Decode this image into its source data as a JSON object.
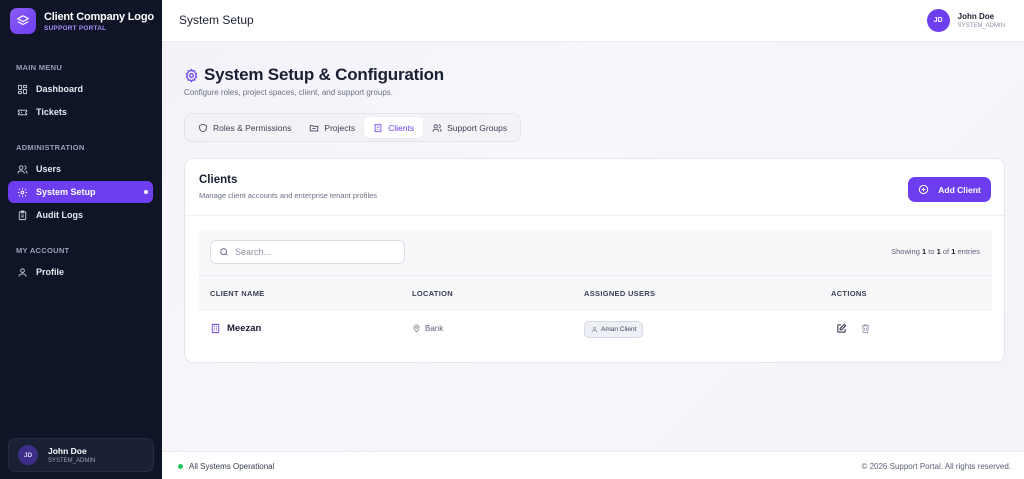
{
  "brand": {
    "title": "Client Company Logo",
    "subtitle": "SUPPORT PORTAL"
  },
  "sidebar": {
    "sections": [
      {
        "label": "MAIN MENU"
      },
      {
        "label": "ADMINISTRATION"
      },
      {
        "label": "MY ACCOUNT"
      }
    ],
    "items": [
      {
        "label": "Dashboard",
        "icon": "dashboard-icon"
      },
      {
        "label": "Tickets",
        "icon": "ticket-icon"
      },
      {
        "label": "Users",
        "icon": "users-icon"
      },
      {
        "label": "System Setup",
        "icon": "gear-icon",
        "active": true
      },
      {
        "label": "Audit Logs",
        "icon": "clipboard-icon"
      },
      {
        "label": "Profile",
        "icon": "user-icon"
      }
    ],
    "user": {
      "initials": "JD",
      "name": "John Doe",
      "role": "SYSTEM_ADMIN"
    }
  },
  "header": {
    "title": "System Setup",
    "user": {
      "initials": "JD",
      "name": "John Doe",
      "role": "SYSTEM_ADMIN"
    }
  },
  "page": {
    "title": "System Setup & Configuration",
    "subtitle": "Configure roles, project spaces, client, and support groups."
  },
  "tabs": [
    {
      "label": "Roles & Permissions",
      "icon": "shield-icon"
    },
    {
      "label": "Projects",
      "icon": "folder-icon"
    },
    {
      "label": "Clients",
      "icon": "building-icon",
      "active": true
    },
    {
      "label": "Support Groups",
      "icon": "users-icon"
    }
  ],
  "clients": {
    "title": "Clients",
    "subtitle": "Manage client accounts and enterprise tenant profiles",
    "add_label": "Add Client",
    "search_placeholder": "Search...",
    "showing": {
      "prefix": "Showing",
      "from": "1",
      "to_word": "to",
      "to": "1",
      "of_word": "of",
      "total": "1",
      "suffix": "entries"
    },
    "columns": [
      "CLIENT NAME",
      "LOCATION",
      "ASSIGNED USERS",
      "ACTIONS"
    ],
    "rows": [
      {
        "name": "Meezan",
        "location": "Bank",
        "assigned_users": [
          "Aman Client"
        ]
      }
    ]
  },
  "footer": {
    "status": "All Systems Operational",
    "copyright": "© 2026 Support Portal. All rights reserved."
  },
  "colors": {
    "accent": "#6d3ef0",
    "sidebar_bg": "#0f1527",
    "status_ok": "#22c55e"
  }
}
